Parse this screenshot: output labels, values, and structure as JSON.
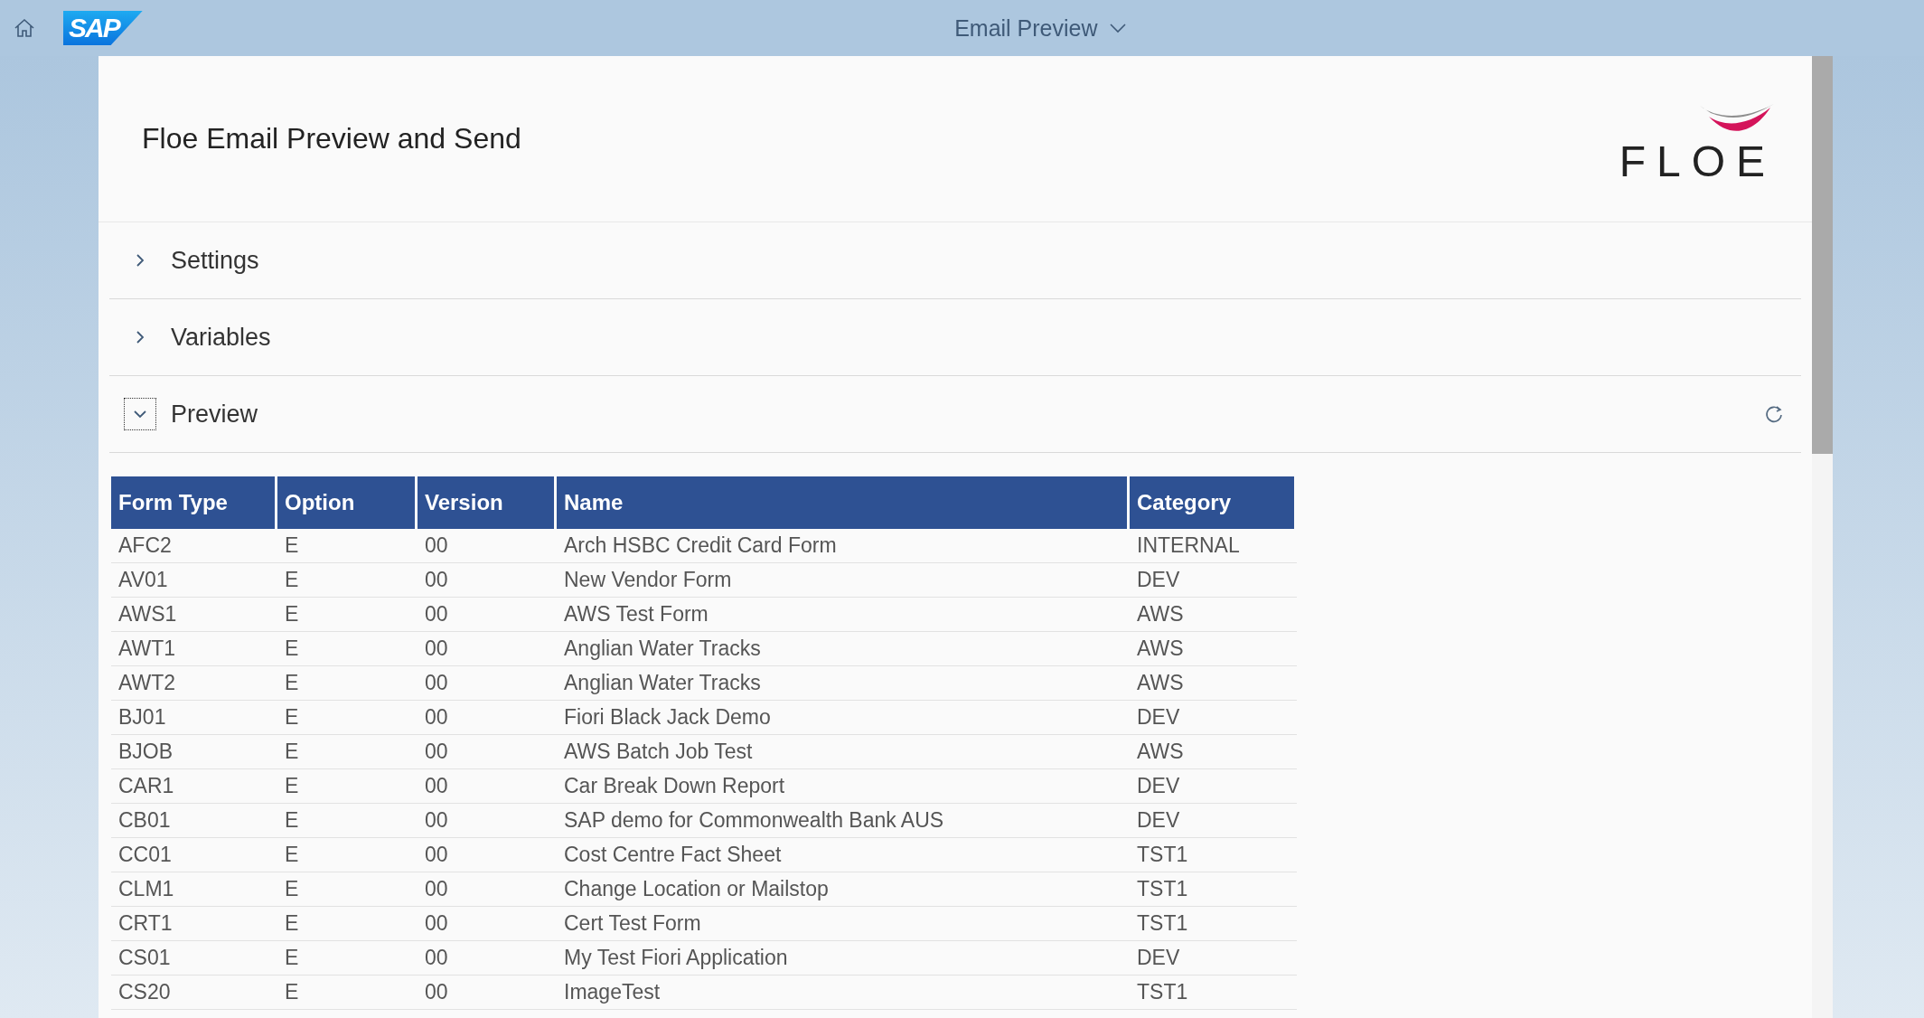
{
  "shell_bar": {
    "title": "Email Preview",
    "logo": "SAP"
  },
  "page": {
    "title": "Floe Email Preview and Send",
    "brand_logo": "FLOE"
  },
  "panels": [
    {
      "label": "Settings",
      "expanded": false
    },
    {
      "label": "Variables",
      "expanded": false
    },
    {
      "label": "Preview",
      "expanded": true
    }
  ],
  "table": {
    "columns": [
      "Form Type",
      "Option",
      "Version",
      "Name",
      "Category"
    ],
    "rows": [
      [
        "AFC2",
        "E",
        "00",
        "Arch HSBC Credit Card Form",
        "INTERNAL"
      ],
      [
        "AV01",
        "E",
        "00",
        "New Vendor Form",
        "DEV"
      ],
      [
        "AWS1",
        "E",
        "00",
        "AWS Test Form",
        "AWS"
      ],
      [
        "AWT1",
        "E",
        "00",
        "Anglian Water Tracks",
        "AWS"
      ],
      [
        "AWT2",
        "E",
        "00",
        "Anglian Water Tracks",
        "AWS"
      ],
      [
        "BJ01",
        "E",
        "00",
        "Fiori Black Jack Demo",
        "DEV"
      ],
      [
        "BJOB",
        "E",
        "00",
        "AWS Batch Job Test",
        "AWS"
      ],
      [
        "CAR1",
        "E",
        "00",
        "Car Break Down Report",
        "DEV"
      ],
      [
        "CB01",
        "E",
        "00",
        "SAP demo for Commonwealth Bank AUS",
        "DEV"
      ],
      [
        "CC01",
        "E",
        "00",
        "Cost Centre Fact Sheet",
        "TST1"
      ],
      [
        "CLM1",
        "E",
        "00",
        "Change Location or Mailstop",
        "TST1"
      ],
      [
        "CRT1",
        "E",
        "00",
        "Cert Test Form",
        "TST1"
      ],
      [
        "CS01",
        "E",
        "00",
        "My Test Fiori Application",
        "DEV"
      ],
      [
        "CS20",
        "E",
        "00",
        "ImageTest",
        "TST1"
      ]
    ]
  }
}
